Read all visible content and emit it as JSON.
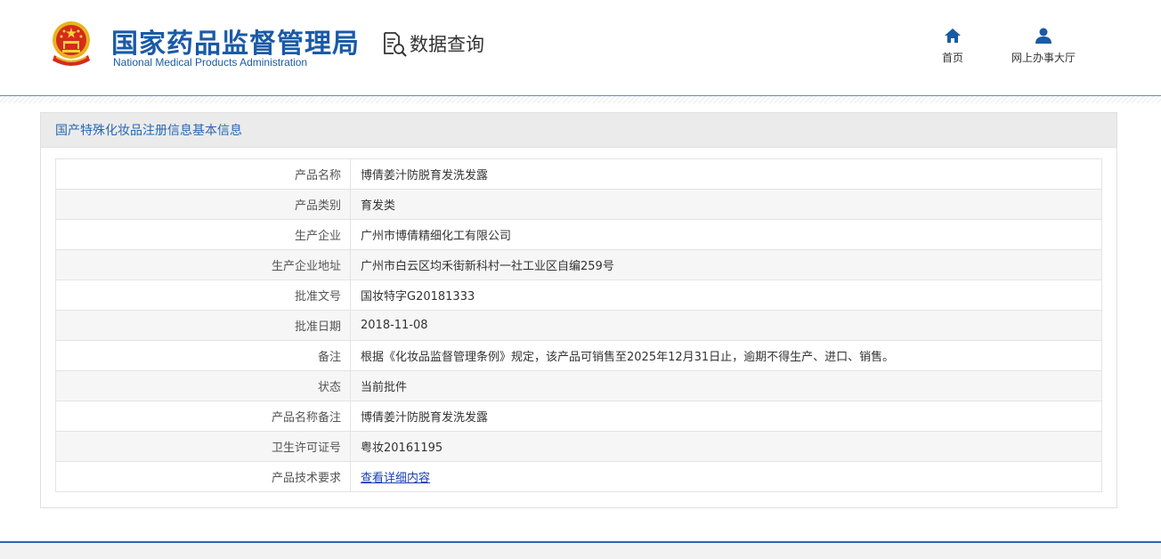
{
  "header": {
    "org_name_cn": "国家药品监督管理局",
    "org_name_en": "National Medical Products Administration",
    "section_title": "数据查询",
    "nav": [
      {
        "label": "首页",
        "icon": "home-icon"
      },
      {
        "label": "网上办事大厅",
        "icon": "user-icon"
      }
    ]
  },
  "panel": {
    "title": "国产特殊化妆品注册信息基本信息",
    "rows": [
      {
        "label": "产品名称",
        "value": "博倩姜汁防脱育发洗发露"
      },
      {
        "label": "产品类别",
        "value": "育发类"
      },
      {
        "label": "生产企业",
        "value": "广州市博倩精细化工有限公司"
      },
      {
        "label": "生产企业地址",
        "value": "广州市白云区均禾街新科村一社工业区自编259号"
      },
      {
        "label": "批准文号",
        "value": "国妆特字G20181333"
      },
      {
        "label": "批准日期",
        "value": "2018-11-08"
      },
      {
        "label": "备注",
        "value": "根据《化妆品监督管理条例》规定，该产品可销售至2025年12月31日止，逾期不得生产、进口、销售。"
      },
      {
        "label": "状态",
        "value": "当前批件"
      },
      {
        "label": "产品名称备注",
        "value": "博倩姜汁防脱育发洗发露"
      },
      {
        "label": "卫生许可证号",
        "value": "粤妆20161195"
      },
      {
        "label": "产品技术要求",
        "value": "查看详细内容"
      }
    ]
  },
  "colors": {
    "brand_blue": "#1a5aa6",
    "link_blue": "#1a3fb3",
    "emblem_red": "#d42b1e",
    "emblem_gold": "#e8b31c"
  }
}
